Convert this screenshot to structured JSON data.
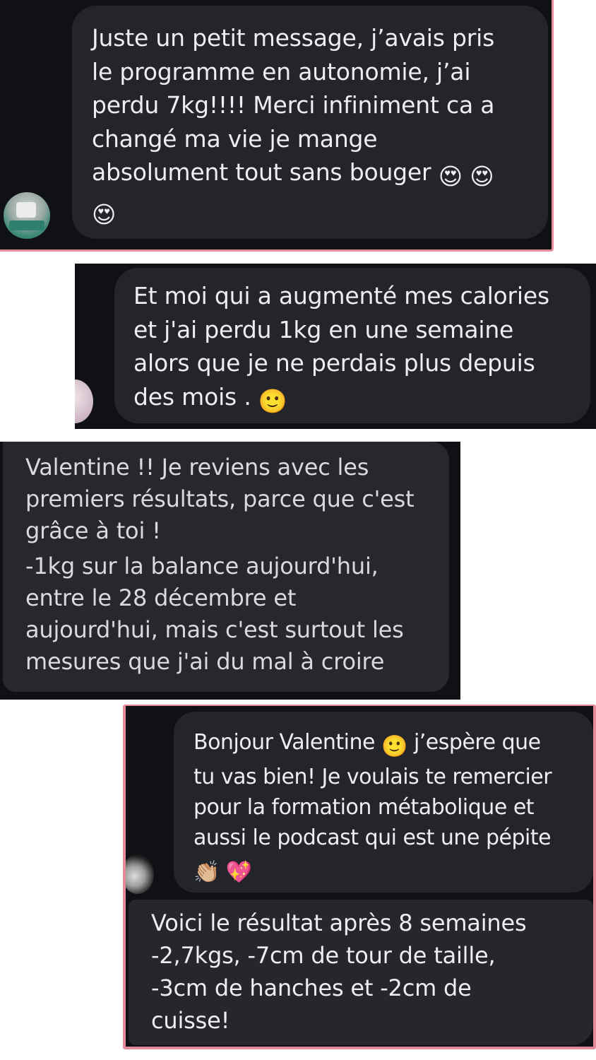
{
  "screenshots": [
    {
      "message": [
        "Juste un petit message, j’avais pris",
        "le programme en autonomie, j’ai",
        "perdu 7kg!!!! Merci infiniment ca a",
        "changé ma vie je mange",
        "absolument tout sans bouger"
      ],
      "emoji": [
        "😍",
        "😍",
        "😍"
      ]
    },
    {
      "message": [
        "Et moi qui a augmenté mes calories",
        "et j'ai perdu 1kg en une semaine",
        "alors que je ne perdais plus depuis",
        "des mois ."
      ],
      "emoji": [
        "🙂"
      ]
    },
    {
      "message": [
        "Valentine !! Je reviens avec les",
        "premiers résultats, parce que c'est",
        "grâce à toi !",
        "-1kg sur la balance aujourd'hui,",
        "entre le 28 décembre et",
        "aujourd'hui, mais c'est surtout les",
        "mesures que j'ai du mal à croire"
      ]
    },
    {
      "message": [
        "Bonjour Valentine",
        "j’espère que",
        "tu vas bien! Je voulais te remercier",
        "pour la formation métabolique et",
        "aussi le podcast qui est une pépite"
      ],
      "emoji": [
        "🙂",
        "👏🏼",
        "💖"
      ],
      "message2": [
        "Voici le résultat après 8 semaines",
        "-2,7kgs, -7cm de tour de taille,",
        "-3cm de hanches et -2cm de",
        "cuisse!"
      ]
    }
  ],
  "colors": {
    "frame_border": "#e58a9a",
    "background_dark": "#0f1115",
    "bubble": "#23252b",
    "text": "#eeeef1"
  }
}
